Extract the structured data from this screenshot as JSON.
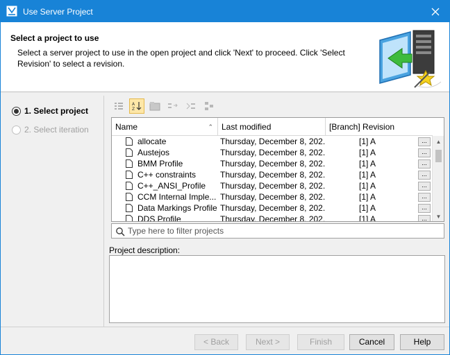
{
  "window": {
    "title": "Use Server Project"
  },
  "header": {
    "title": "Select a project to use",
    "description": "Select a server project to use in the open project and click 'Next' to proceed. Click 'Select Revision' to select a revision."
  },
  "steps": [
    {
      "label": "1. Select project",
      "state": "active"
    },
    {
      "label": "2. Select iteration",
      "state": "disabled"
    }
  ],
  "table": {
    "columns": [
      "Name",
      "Last modified",
      "[Branch] Revision"
    ],
    "rows": [
      {
        "name": "allocate",
        "modified": "Thursday, December 8, 202...",
        "revision": "[1] A"
      },
      {
        "name": "Austejos",
        "modified": "Thursday, December 8, 202...",
        "revision": "[1] A"
      },
      {
        "name": "BMM Profile",
        "modified": "Thursday, December 8, 202...",
        "revision": "[1] A"
      },
      {
        "name": "C++ constraints",
        "modified": "Thursday, December 8, 202...",
        "revision": "[1] A"
      },
      {
        "name": "C++_ANSI_Profile",
        "modified": "Thursday, December 8, 202...",
        "revision": "[1] A"
      },
      {
        "name": "CCM Internal Imple...",
        "modified": "Thursday, December 8, 202...",
        "revision": "[1] A"
      },
      {
        "name": "Data Markings Profile",
        "modified": "Thursday, December 8, 202...",
        "revision": "[1] A"
      },
      {
        "name": "DDS Profile",
        "modified": "Thursday, December 8, 202...",
        "revision": "[1] A"
      }
    ],
    "more_label": "..."
  },
  "filter": {
    "placeholder": "Type here to filter projects"
  },
  "description": {
    "label": "Project description:"
  },
  "buttons": {
    "back": "< Back",
    "next": "Next >",
    "finish": "Finish",
    "cancel": "Cancel",
    "help": "Help"
  },
  "colors": {
    "titlebar": "#1883d7",
    "accent_sort": "#fde7a8"
  }
}
